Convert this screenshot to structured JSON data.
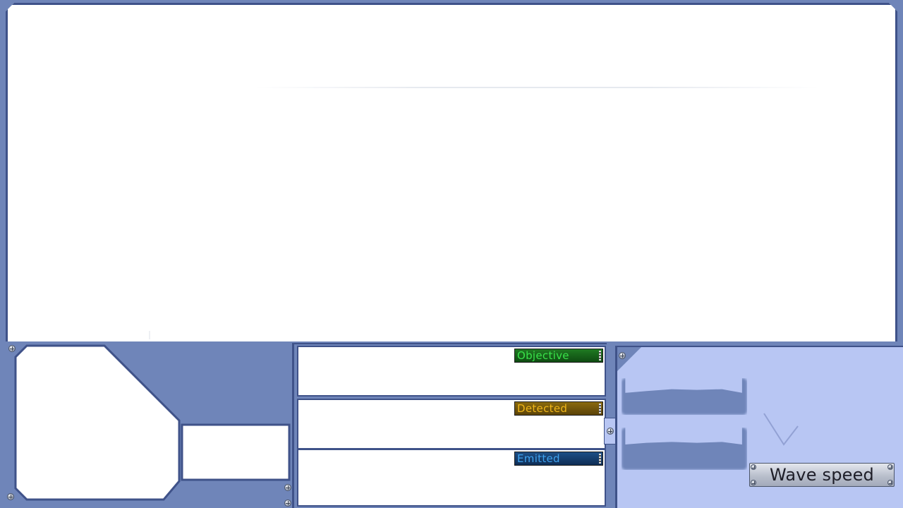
{
  "panels": {
    "objective_label": "Objective",
    "detected_label": "Detected",
    "emitted_label": "Emitted"
  },
  "controls": {
    "wave_speed_label": "Wave speed"
  },
  "colors": {
    "frame": "#6f85b9",
    "frame_dark": "#3f5289",
    "control_bg": "#b8c6f3",
    "objective": "#39e24a",
    "detected": "#f0b619",
    "emitted": "#3fa2ee"
  }
}
